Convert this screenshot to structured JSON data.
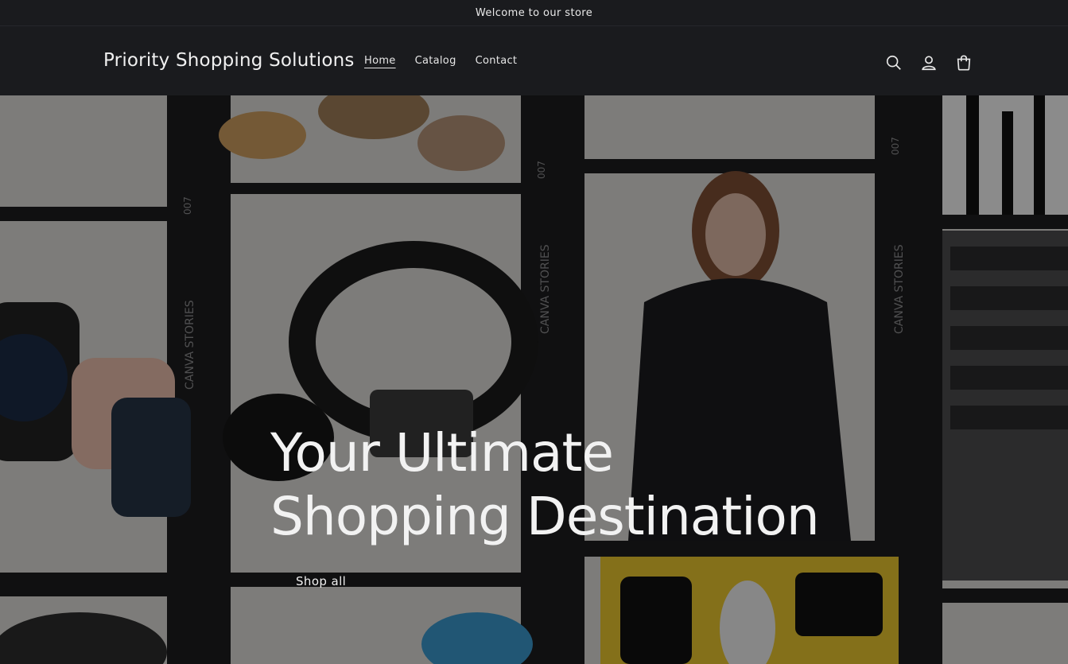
{
  "announcement": {
    "text": "Welcome to our store"
  },
  "header": {
    "logo": "Priority Shopping Solutions",
    "nav": [
      {
        "label": "Home",
        "active": true
      },
      {
        "label": "Catalog",
        "active": false
      },
      {
        "label": "Contact",
        "active": false
      }
    ],
    "icons": [
      "search-icon",
      "account-icon",
      "cart-icon"
    ]
  },
  "hero": {
    "title_line1": "Your Ultimate",
    "title_line2": "Shopping Destination",
    "button_label": "Shop all",
    "film_text": "CANVA STORIES",
    "film_number": "007"
  },
  "colors": {
    "header_bg": "#1a1b1e",
    "text": "#eeeeee",
    "overlay": "rgba(0,0,0,0.42)"
  }
}
